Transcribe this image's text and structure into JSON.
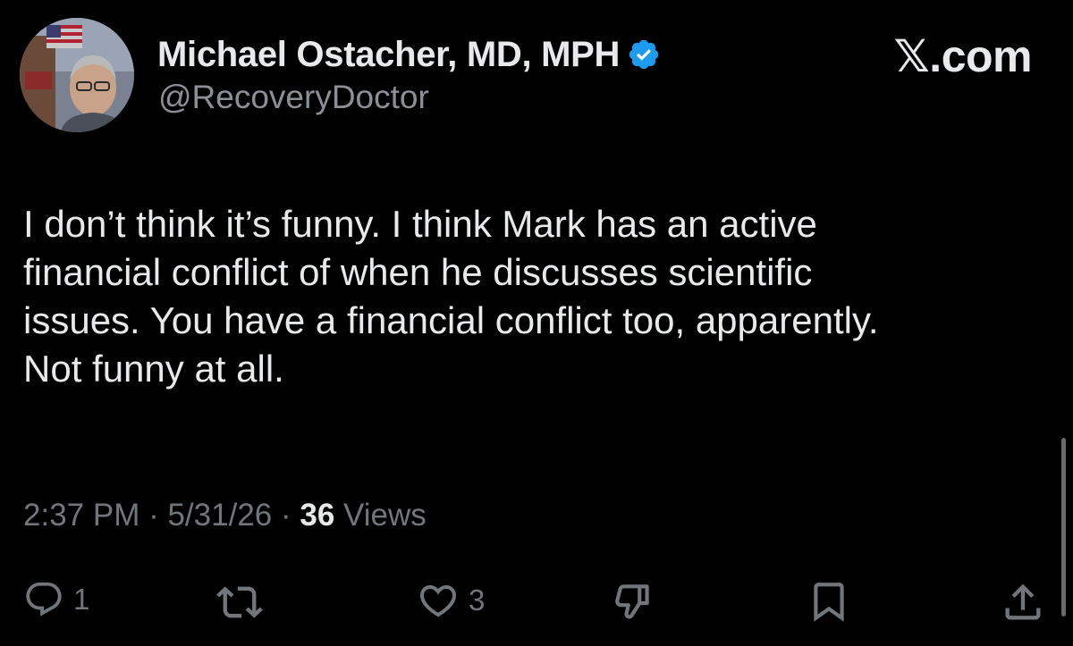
{
  "author": {
    "display_name": "Michael Ostacher, MD, MPH",
    "handle": "@RecoveryDoctor",
    "verified": true,
    "verified_color": "#1d9bf0",
    "avatar_icon": "profile-photo"
  },
  "brand": {
    "label": "𝕏.com"
  },
  "tweet": {
    "lines": [
      "I don’t think it’s funny. I think Mark has an active",
      "financial conflict of when he discusses scientific",
      "issues. You have a financial conflict too, apparently.",
      "Not funny at all."
    ]
  },
  "meta": {
    "time": "2:37 PM",
    "separator": " · ",
    "date": "5/31/26",
    "views_count": "36",
    "views_label": " Views"
  },
  "actions": {
    "reply_count": "1",
    "repost_count": "",
    "like_count": "3"
  },
  "colors": {
    "background": "#000000",
    "text_primary": "#e7e9ea",
    "text_secondary": "#71767b"
  }
}
